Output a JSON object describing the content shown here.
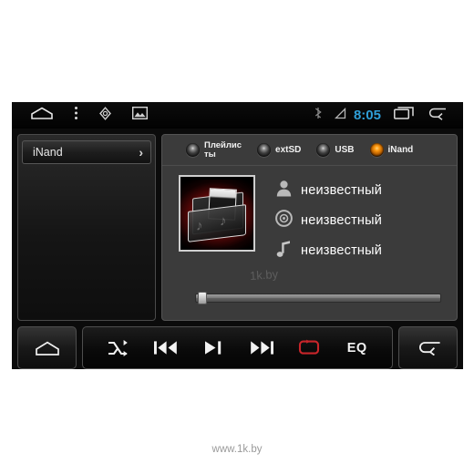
{
  "page": {
    "background": "#ffffff",
    "watermark": "www.1k.by"
  },
  "device": {
    "screen_bg": "#0b0b0b",
    "accent_on": "#ff9a10",
    "repeat_active_color": "#c8252a",
    "clock_color": "#2f9fd8"
  },
  "statusbar": {
    "left_icons": [
      {
        "name": "home-icon",
        "label": "home"
      },
      {
        "name": "menu-dots-icon",
        "label": "menu"
      },
      {
        "name": "navigation-icon",
        "label": "navigation"
      },
      {
        "name": "gallery-icon",
        "label": "gallery"
      }
    ],
    "bluetooth_icon": "bluetooth-icon",
    "signal_icon": "signal-triangle-icon",
    "clock": "8:05",
    "recents_icon": "recent-apps-icon",
    "back_icon": "back-arrow-icon"
  },
  "left_panel": {
    "selected_source": "iNand",
    "chevron": "›"
  },
  "sources": [
    {
      "label": "Плейлисты",
      "selected": false,
      "two_line": [
        "Плейлис",
        "ты"
      ]
    },
    {
      "label": "extSD",
      "selected": false
    },
    {
      "label": "USB",
      "selected": false
    },
    {
      "label": "iNand",
      "selected": true
    }
  ],
  "now_playing": {
    "album_art_name": "folder-album-art",
    "artist_icon": "person-icon",
    "album_icon": "disc-icon",
    "title_icon": "music-note-icon",
    "artist": "неизвестный",
    "album": "неизвестный",
    "title": "неизвестный",
    "inner_watermark": "1k.by"
  },
  "seek": {
    "progress_percent": 1,
    "position_label": "",
    "duration_label": ""
  },
  "controls": {
    "home_button": "home-button",
    "back_button": "back-button",
    "transport": [
      {
        "name": "shuffle-button",
        "label": "shuffle",
        "active": false
      },
      {
        "name": "previous-track-button",
        "label": "previous",
        "active": false
      },
      {
        "name": "play-pause-button",
        "label": "play/pause",
        "active": false
      },
      {
        "name": "next-track-button",
        "label": "next",
        "active": false
      },
      {
        "name": "repeat-button",
        "label": "repeat",
        "active": true
      },
      {
        "name": "equalizer-button",
        "label": "EQ",
        "active": false
      }
    ],
    "eq_label": "EQ"
  }
}
